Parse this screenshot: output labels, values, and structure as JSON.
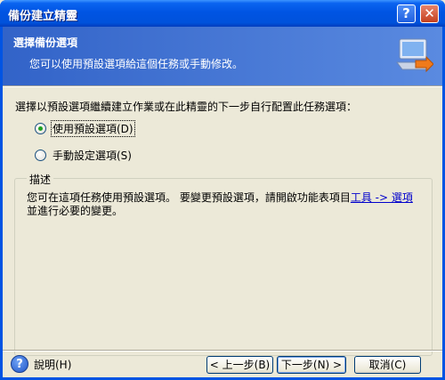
{
  "window": {
    "title": "備份建立精靈",
    "help_glyph": "?",
    "close_glyph": "✕"
  },
  "header": {
    "title": "選擇備份選項",
    "subtitle": "您可以使用預設選項給這個任務或手動修改。",
    "icon": "computer-arrow-icon"
  },
  "instruction": "選擇以預設選項繼續建立作業或在此精靈的下一步自行配置此任務選項：",
  "options": [
    {
      "label": "使用預設選項(D)",
      "checked": true
    },
    {
      "label": "手動設定選項(S)",
      "checked": false
    }
  ],
  "description": {
    "legend": "描述",
    "text_before": "您可在這項任務使用預設選項。 要變更預設選項，請開啟功能表項目",
    "link_tools": "工具 -> 選項",
    "text_after": "並進行必要的變更。"
  },
  "footer": {
    "help_label": "說明(H)",
    "back_label": "< 上一步(B)",
    "next_label": "下一步(N) >",
    "cancel_label": "取消(C)"
  },
  "colors": {
    "title_bar": "#0054e3",
    "header_bg": "#3263c8",
    "dialog_bg": "#ece9d8",
    "link": "#0000cc"
  }
}
